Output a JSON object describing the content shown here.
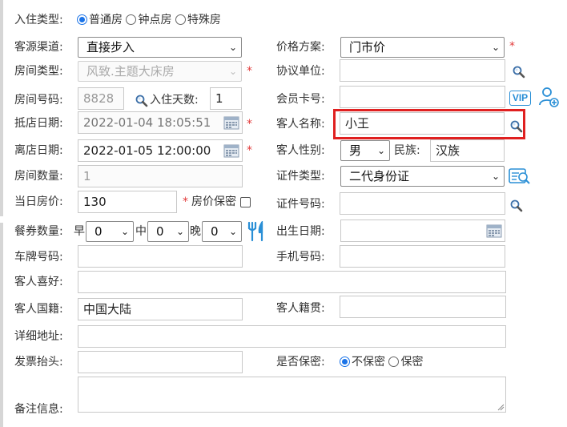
{
  "form": {
    "checkin_type": {
      "label": "入住类型:",
      "options": [
        "普通房",
        "钟点房",
        "特殊房"
      ]
    },
    "source_channel": {
      "label": "客源渠道:",
      "value": "直接步入"
    },
    "price_plan": {
      "label": "价格方案:",
      "value": "门市价"
    },
    "room_type": {
      "label": "房间类型:",
      "value": "风致.主题大床房"
    },
    "agreement_unit": {
      "label": "协议单位:",
      "value": ""
    },
    "room_no": {
      "label": "房间号码:",
      "value": "8828"
    },
    "stay_days": {
      "label": "入住天数:",
      "value": "1"
    },
    "member_card": {
      "label": "会员卡号:",
      "value": ""
    },
    "vip_label": "VIP",
    "arrive_date": {
      "label": "抵店日期:",
      "value": "2022-01-04 18:05:51"
    },
    "guest_name": {
      "label": "客人名称:",
      "value": "小王"
    },
    "leave_date": {
      "label": "离店日期:",
      "value": "2022-01-05 12:00:00"
    },
    "guest_gender": {
      "label": "客人性别:",
      "value": "男"
    },
    "ethnicity": {
      "label": "民族:",
      "value": "汉族"
    },
    "room_count": {
      "label": "房间数量:",
      "value": "1"
    },
    "id_type": {
      "label": "证件类型:",
      "value": "二代身份证"
    },
    "daily_price": {
      "label": "当日房价:",
      "value": "130"
    },
    "price_secret": {
      "label": "房价保密"
    },
    "id_number": {
      "label": "证件号码:",
      "value": ""
    },
    "meal": {
      "label": "餐券数量:",
      "breakfast_label": "早",
      "breakfast": "0",
      "lunch_label": "中",
      "lunch": "0",
      "dinner_label": "晚",
      "dinner": "0"
    },
    "birthday": {
      "label": "出生日期:",
      "value": ""
    },
    "plate": {
      "label": "车牌号码:",
      "value": ""
    },
    "phone": {
      "label": "手机号码:",
      "value": ""
    },
    "preference": {
      "label": "客人喜好:",
      "value": ""
    },
    "nationality": {
      "label": "客人国籍:",
      "value": "中国大陆"
    },
    "native_place": {
      "label": "客人籍贯:",
      "value": ""
    },
    "address": {
      "label": "详细地址:",
      "value": ""
    },
    "invoice": {
      "label": "发票抬头:",
      "value": ""
    },
    "secret": {
      "label": "是否保密:",
      "options": [
        "不保密",
        "保密"
      ]
    },
    "remark": {
      "label": "备注信息:",
      "value": ""
    },
    "required_mark": "*"
  },
  "colors": {
    "accent": "#1a73e8",
    "required": "#e23b3b",
    "highlight": "#e02020",
    "icon_blue": "#2a8fd6"
  }
}
